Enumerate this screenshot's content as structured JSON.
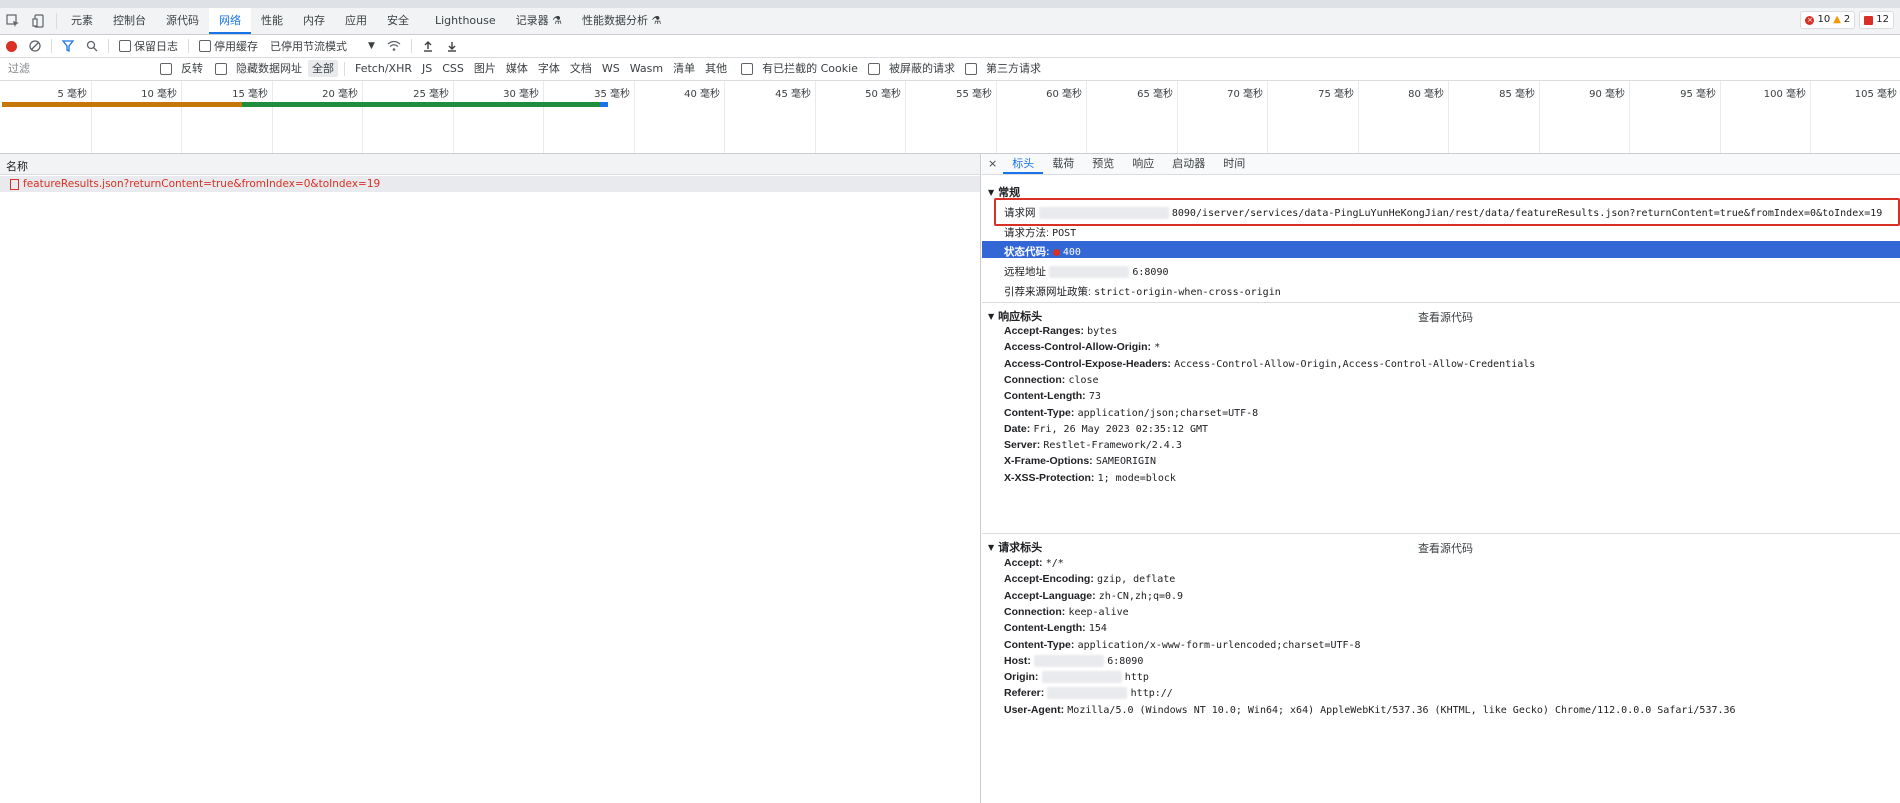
{
  "top_tabs": [
    "元素",
    "控制台",
    "源代码",
    "网络",
    "性能",
    "内存",
    "应用",
    "安全",
    "Lighthouse",
    "记录器 ⚗",
    "性能数据分析 ⚗"
  ],
  "counts": {
    "errors": "10",
    "warnings": "2",
    "issues": "12"
  },
  "toolbar": {
    "preserve_log": "保留日志",
    "disable_cache": "停用缓存",
    "throttling": "已停用节流模式"
  },
  "filter": {
    "placeholder": "过滤",
    "invert": "反转",
    "hide_data_urls": "隐藏数据网址",
    "types": [
      "全部",
      "Fetch/XHR",
      "JS",
      "CSS",
      "图片",
      "媒体",
      "字体",
      "文档",
      "WS",
      "Wasm",
      "清单",
      "其他"
    ],
    "blocked_cookies": "有已拦截的 Cookie",
    "blocked_requests": "被屏蔽的请求",
    "third_party": "第三方请求"
  },
  "overview": {
    "ticks": [
      "5 毫秒",
      "10 毫秒",
      "15 毫秒",
      "20 毫秒",
      "25 毫秒",
      "30 毫秒",
      "35 毫秒",
      "40 毫秒",
      "45 毫秒",
      "50 毫秒",
      "55 毫秒",
      "60 毫秒",
      "65 毫秒",
      "70 毫秒",
      "75 毫秒",
      "80 毫秒",
      "85 毫秒",
      "90 毫秒",
      "95 毫秒",
      "100 毫秒",
      "105 毫秒"
    ]
  },
  "list": {
    "header": "名称",
    "request": "featureResults.json?returnContent=true&fromIndex=0&toIndex=19"
  },
  "detail_tabs": [
    "×",
    "标头",
    "载荷",
    "预览",
    "响应",
    "启动器",
    "时间"
  ],
  "general": {
    "title": "常规",
    "rows": [
      {
        "k": "请求网",
        "v": "8090/iserver/services/data-PingLuYunHeKongJian/rest/data/featureResults.json?returnContent=true&fromIndex=0&toIndex=19"
      },
      {
        "k": "请求方法:",
        "v": "POST"
      },
      {
        "k": "状态代码:",
        "v": "400"
      },
      {
        "k": "远程地址",
        "v": "6:8090"
      },
      {
        "k": "引荐来源网址政策:",
        "v": "strict-origin-when-cross-origin"
      }
    ]
  },
  "response_headers": {
    "title": "响应标头",
    "view_source": "查看源代码",
    "rows": [
      {
        "k": "Accept-Ranges:",
        "v": "bytes"
      },
      {
        "k": "Access-Control-Allow-Origin:",
        "v": "*"
      },
      {
        "k": "Access-Control-Expose-Headers:",
        "v": "Access-Control-Allow-Origin,Access-Control-Allow-Credentials"
      },
      {
        "k": "Connection:",
        "v": "close"
      },
      {
        "k": "Content-Length:",
        "v": "73"
      },
      {
        "k": "Content-Type:",
        "v": "application/json;charset=UTF-8"
      },
      {
        "k": "Date:",
        "v": "Fri, 26 May 2023 02:35:12 GMT"
      },
      {
        "k": "Server:",
        "v": "Restlet-Framework/2.4.3"
      },
      {
        "k": "X-Frame-Options:",
        "v": "SAMEORIGIN"
      },
      {
        "k": "X-XSS-Protection:",
        "v": "1; mode=block"
      }
    ]
  },
  "request_headers": {
    "title": "请求标头",
    "view_source": "查看源代码",
    "rows": [
      {
        "k": "Accept:",
        "v": "*/*"
      },
      {
        "k": "Accept-Encoding:",
        "v": "gzip, deflate"
      },
      {
        "k": "Accept-Language:",
        "v": "zh-CN,zh;q=0.9"
      },
      {
        "k": "Connection:",
        "v": "keep-alive"
      },
      {
        "k": "Content-Length:",
        "v": "154"
      },
      {
        "k": "Content-Type:",
        "v": "application/x-www-form-urlencoded;charset=UTF-8"
      },
      {
        "k": "Host:",
        "v": "6:8090"
      },
      {
        "k": "Origin:",
        "v": "http"
      },
      {
        "k": "Referer:",
        "v": "http://"
      },
      {
        "k": "User-Agent:",
        "v": "Mozilla/5.0 (Windows NT 10.0; Win64; x64) AppleWebKit/537.36 (KHTML, like Gecko) Chrome/112.0.0.0 Safari/537.36"
      }
    ]
  },
  "colors": {
    "accent": "#1a73e8",
    "error": "#d93025",
    "selected_row": "#3367d6",
    "highlight_box": "#d93025"
  }
}
